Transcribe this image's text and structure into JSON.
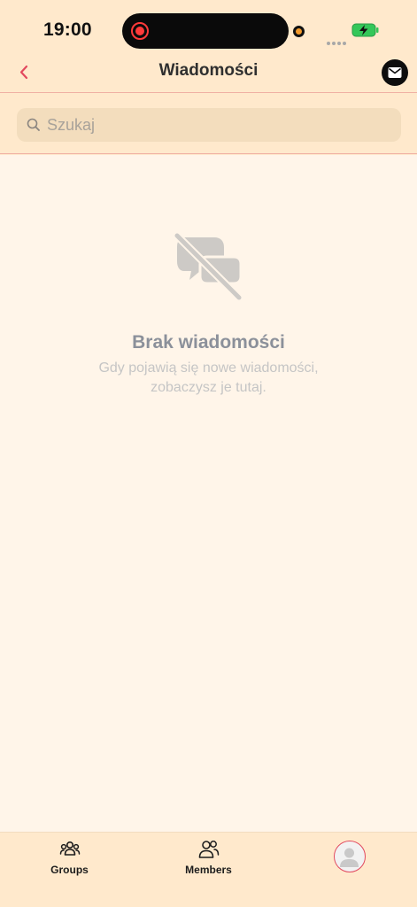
{
  "status_bar": {
    "time": "19:00",
    "battery_color": "#34c759"
  },
  "header": {
    "title": "Wiadomości",
    "back_icon": "chevron-left-icon",
    "mail_icon": "envelope-icon",
    "accent_color": "#e2495e"
  },
  "search": {
    "placeholder": "Szukaj",
    "value": ""
  },
  "empty_state": {
    "icon": "chat-off-icon",
    "title": "Brak wiadomości",
    "line1": "Gdy pojawią się nowe wiadomości,",
    "line2": "zobaczysz je tutaj."
  },
  "tab_bar": {
    "tabs": [
      {
        "label": "Groups",
        "icon": "groups-icon"
      },
      {
        "label": "Members",
        "icon": "members-icon"
      },
      {
        "label": "",
        "icon": "avatar-icon"
      }
    ]
  }
}
